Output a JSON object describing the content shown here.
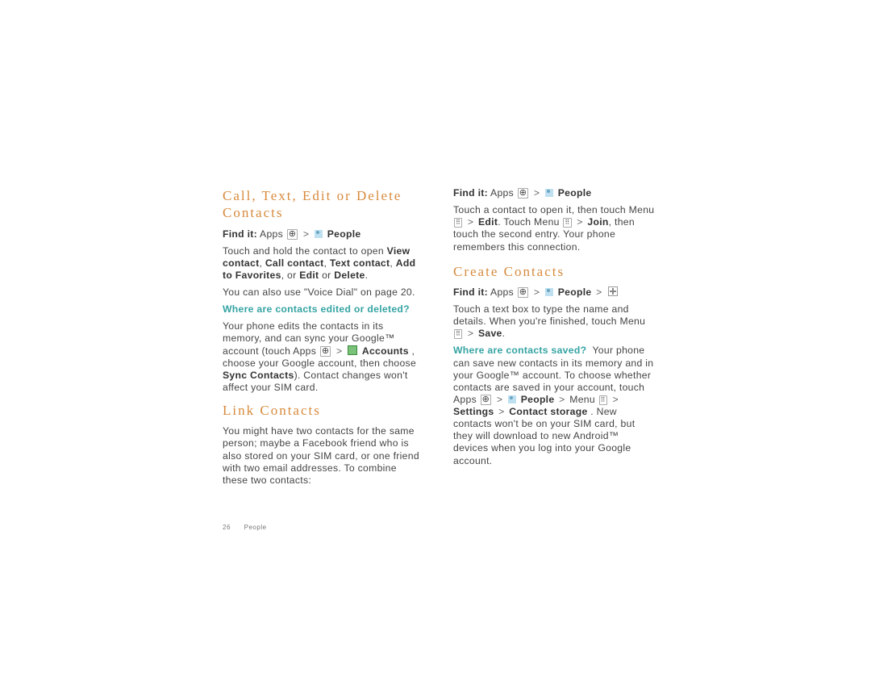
{
  "colors": {
    "heading": "#d78a3d",
    "question": "#35a3a3"
  },
  "footer": {
    "page_number": "26",
    "section": "People"
  },
  "icons": {
    "apps": "apps-icon",
    "people": "people-icon",
    "menu": "menu-icon",
    "accounts": "accounts-icon",
    "add": "add-plus-icon"
  },
  "common": {
    "findit_label": "Find it:",
    "apps": "Apps",
    "people": "People",
    "menu": "Menu",
    "gt": ">"
  },
  "left": {
    "h1": "Call, Text, Edit or Delete Contacts",
    "p1a": "Touch and hold the contact to open ",
    "view_contact": "View contact",
    "comma": ", ",
    "call_contact": "Call contact",
    "text_contact": "Text contact",
    "add_fav": "Add to Favorites",
    "or": ", or ",
    "edit": "Edit",
    "or2": " or ",
    "delete": "Delete",
    "period": ".",
    "p2": "You can also use \"Voice Dial\" on page 20.",
    "q1": "Where are contacts edited or deleted?",
    "p3a": "Your phone edits the contacts in its memory, and can sync your Google™ account (touch Apps",
    "accounts": "Accounts",
    "p3b": ", choose your Google account, then choose ",
    "sync": "Sync Contacts",
    "p3c": "). Contact changes won't affect your SIM card.",
    "h2": "Link Contacts",
    "p4": "You might have two contacts for the same person; maybe a Facebook friend who is also stored on your SIM card, or one friend with two email addresses. To combine these two contacts:"
  },
  "right": {
    "p1a": "Touch a contact to open it, then touch Menu",
    "editw": "Edit",
    "p1b": ". Touch Menu",
    "join": "Join",
    "p1c": ", then touch the second entry. Your phone remembers this connection.",
    "h1": "Create Contacts",
    "p2a": "Touch a text box to type the name and details. When you're finished, touch Menu",
    "save": "Save",
    "q1": "Where are contacts saved?",
    "p3a": "Your phone can save new contacts in its memory and in your Google™ account. To choose whether contacts are saved in your account, touch Apps",
    "settings": "Settings",
    "cstore": "Contact storage",
    "p3b": ". New contacts won't be on your SIM card, but they will download to new Android™ devices when you log into your Google account."
  }
}
